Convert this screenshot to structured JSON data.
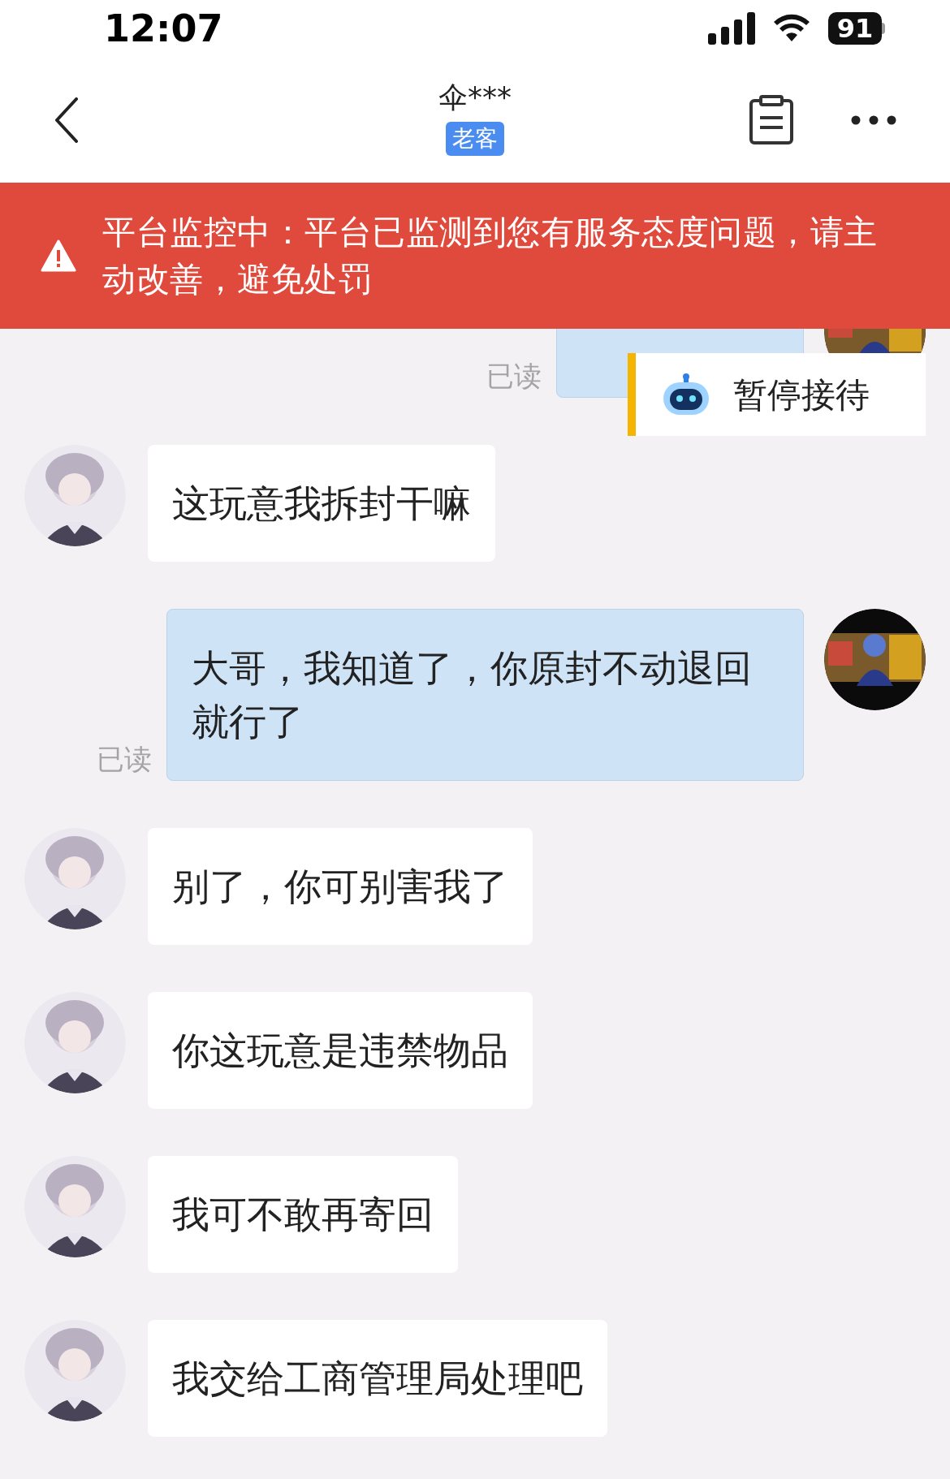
{
  "status_bar": {
    "time": "12:07",
    "battery": "91"
  },
  "header": {
    "title": "伞***",
    "badge": "老客"
  },
  "banner": {
    "text": "平台监控中：平台已监测到您有服务态度问题，请主动改善，避免处罚"
  },
  "pause_overlay": {
    "label": "暂停接待"
  },
  "messages": [
    {
      "kind": "outgoing",
      "read_label": "已读"
    },
    {
      "kind": "incoming",
      "text": "这玩意我拆封干嘛"
    },
    {
      "kind": "outgoing",
      "text": "大哥，我知道了，你原封不动退回就行了",
      "read_label": "已读"
    },
    {
      "kind": "incoming",
      "text": "别了，你可别害我了"
    },
    {
      "kind": "incoming",
      "text": "你这玩意是违禁物品"
    },
    {
      "kind": "incoming",
      "text": "我可不敢再寄回"
    },
    {
      "kind": "incoming",
      "text": "我交给工商管理局处理吧"
    }
  ]
}
